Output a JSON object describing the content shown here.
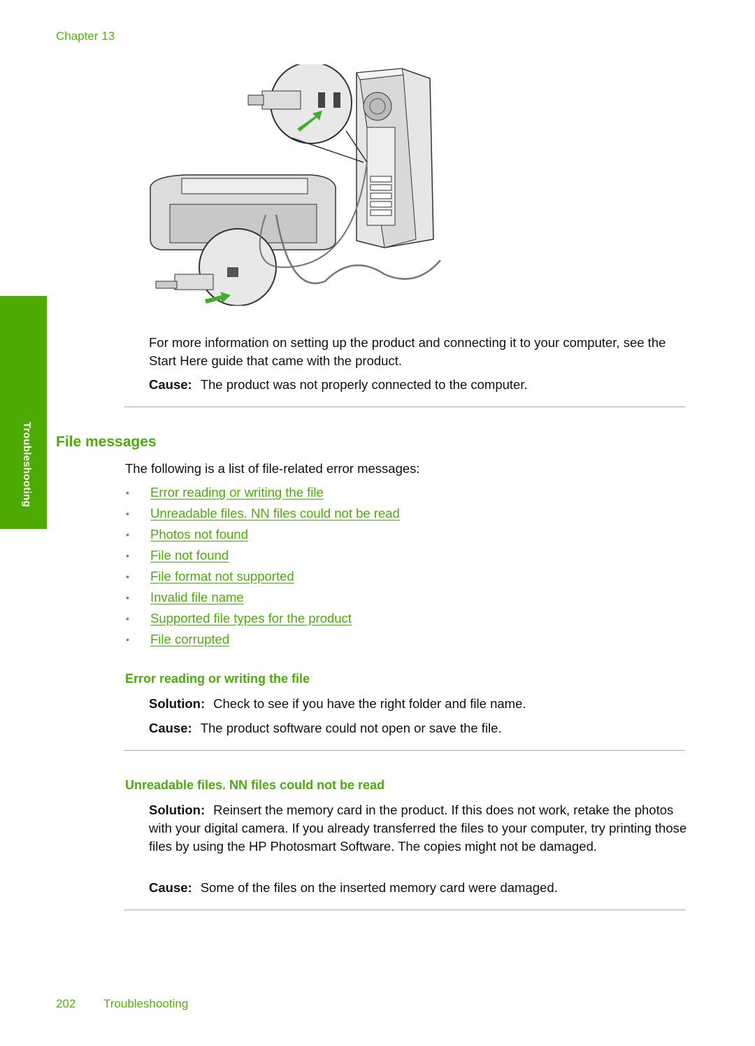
{
  "header": {
    "chapter": "Chapter 13"
  },
  "side_tab": {
    "label": "Troubleshooting"
  },
  "figure": {
    "description": "USB cable connecting printer rear port to computer USB port",
    "alt": "usb-connection-illustration"
  },
  "intro": {
    "paragraph": "For more information on setting up the product and connecting it to your computer, see the Start Here guide that came with the product.",
    "cause_label": "Cause:",
    "cause_text": "The product was not properly connected to the computer."
  },
  "section": {
    "title": "File messages",
    "lead": "The following is a list of file-related error messages:",
    "links": [
      "Error reading or writing the file",
      "Unreadable files. NN files could not be read",
      "Photos not found",
      "File not found",
      "File format not supported",
      "Invalid file name",
      "Supported file types for the product",
      "File corrupted"
    ]
  },
  "sub1": {
    "title": "Error reading or writing the file",
    "solution_label": "Solution:",
    "solution_text": "Check to see if you have the right folder and file name.",
    "cause_label": "Cause:",
    "cause_text": "The product software could not open or save the file."
  },
  "sub2": {
    "title": "Unreadable files. NN files could not be read",
    "solution_label": "Solution:",
    "solution_text": "Reinsert the memory card in the product. If this does not work, retake the photos with your digital camera. If you already transferred the files to your computer, try printing those files by using the HP Photosmart Software. The copies might not be damaged.",
    "cause_label": "Cause:",
    "cause_text": "Some of the files on the inserted memory card were damaged."
  },
  "footer": {
    "page_number": "202",
    "section": "Troubleshooting"
  },
  "colors": {
    "accent": "#4cac0e",
    "tab": "#4caa03",
    "rule": "#a8a8a8"
  }
}
